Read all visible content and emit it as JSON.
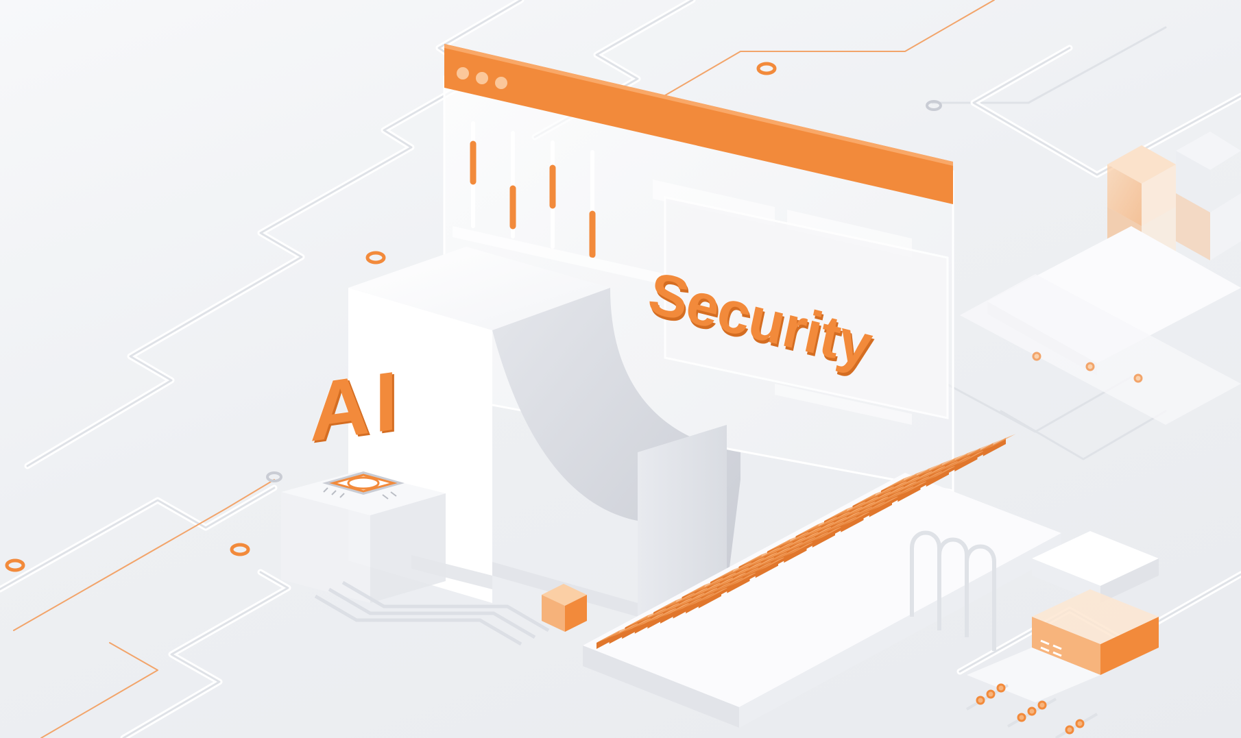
{
  "scene": {
    "headline_word": "Security",
    "secondary_word": "AI",
    "accent_color": "#f28a3b",
    "accent_dark": "#d46d22",
    "surface_color": "#f1f2f5",
    "object_white": "#ffffff",
    "shadow_grey": "#d8dbe1"
  },
  "browser_window": {
    "icon": "browser-window-icon",
    "dots": [
      "dot",
      "dot",
      "dot"
    ]
  }
}
